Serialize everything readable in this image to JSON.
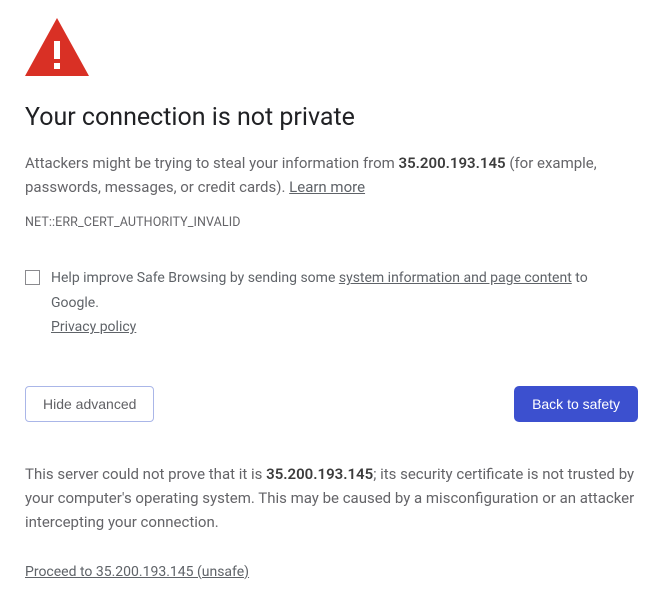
{
  "title": "Your connection is not private",
  "description": {
    "prefix": "Attackers might be trying to steal your information from ",
    "host": "35.200.193.145",
    "suffix": " (for example, passwords, messages, or credit cards). ",
    "learn_more": "Learn more"
  },
  "error_code": "NET::ERR_CERT_AUTHORITY_INVALID",
  "opt_in": {
    "prefix": "Help improve Safe Browsing by sending some ",
    "link1": "system information and page content",
    "middle": " to Google. ",
    "link2": "Privacy policy"
  },
  "buttons": {
    "advanced": "Hide advanced",
    "safety": "Back to safety"
  },
  "explanation": {
    "prefix": "This server could not prove that it is ",
    "host": "35.200.193.145",
    "suffix": "; its security certificate is not trusted by your computer's operating system. This may be caused by a misconfiguration or an attacker intercepting your connection."
  },
  "proceed": "Proceed to 35.200.193.145 (unsafe)"
}
